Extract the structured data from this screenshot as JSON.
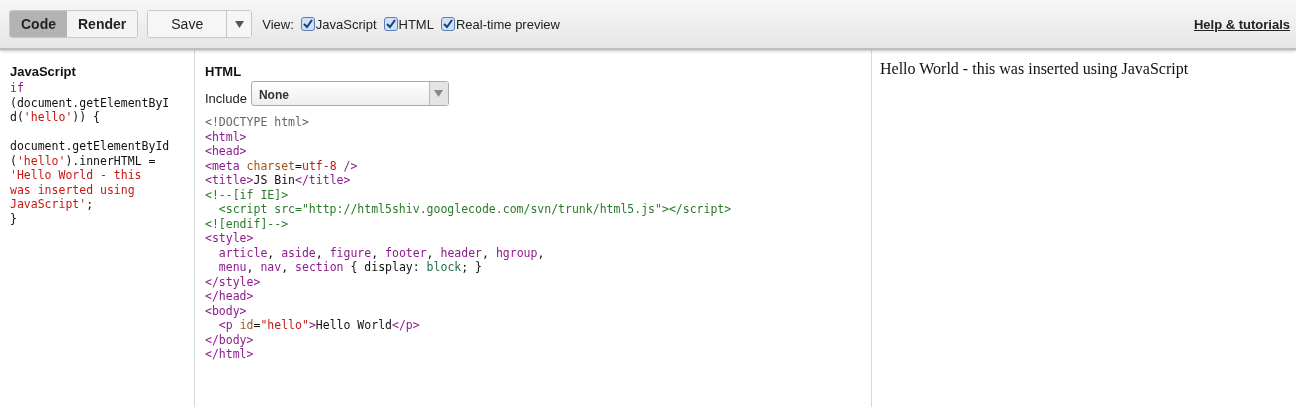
{
  "toolbar": {
    "mode_tabs": [
      {
        "label": "Code",
        "selected": true
      },
      {
        "label": "Render",
        "selected": false
      }
    ],
    "save_button": {
      "label": "Save"
    },
    "view_label": "View:",
    "view_options": [
      {
        "label": "JavaScript",
        "checked": true
      },
      {
        "label": "HTML",
        "checked": true
      },
      {
        "label": "Real-time preview",
        "checked": true
      }
    ],
    "help_link": "Help & tutorials"
  },
  "javascript_panel": {
    "title": "JavaScript",
    "lines": [
      [
        {
          "kind": "keyword",
          "text": "if"
        }
      ],
      [
        {
          "kind": "plain",
          "text": "(document.getElementByI"
        }
      ],
      [
        {
          "kind": "plain",
          "text": "d("
        },
        {
          "kind": "string",
          "text": "'hello'"
        },
        {
          "kind": "plain",
          "text": ")) {"
        }
      ],
      [
        {
          "kind": "plain",
          "text": "document.getElementById",
          "blank_before": true
        }
      ],
      [
        {
          "kind": "plain",
          "text": "("
        },
        {
          "kind": "string",
          "text": "'hello'"
        },
        {
          "kind": "plain",
          "text": ").innerHTML ="
        }
      ],
      [
        {
          "kind": "string",
          "text": "'Hello World - this"
        }
      ],
      [
        {
          "kind": "string",
          "text": "was inserted using"
        }
      ],
      [
        {
          "kind": "string",
          "text": "JavaScript'"
        },
        {
          "kind": "plain",
          "text": ";"
        }
      ],
      [
        {
          "kind": "plain",
          "text": "}"
        }
      ]
    ]
  },
  "html_panel": {
    "title": "HTML",
    "include_label": "Include",
    "include_value": "None",
    "lines": [
      [
        {
          "kind": "doctype",
          "text": "<!DOCTYPE html>"
        }
      ],
      [
        {
          "kind": "tag",
          "text": "<html>"
        }
      ],
      [
        {
          "kind": "tag",
          "text": "<head>"
        }
      ],
      [
        {
          "kind": "tag",
          "text": "<meta "
        },
        {
          "kind": "attr",
          "text": "charset"
        },
        {
          "kind": "plain",
          "text": "="
        },
        {
          "kind": "string",
          "text": "utf-8"
        },
        {
          "kind": "tag",
          "text": " />"
        }
      ],
      [
        {
          "kind": "tag",
          "text": "<title>"
        },
        {
          "kind": "plain",
          "text": "JS Bin"
        },
        {
          "kind": "tag",
          "text": "</title>"
        }
      ],
      [
        {
          "kind": "comment",
          "text": "<!--[if IE]>"
        }
      ],
      [
        {
          "kind": "comment",
          "text": "  <script src=\"http://html5shiv.googlecode.com/svn/trunk/html5.js\"></script>"
        }
      ],
      [
        {
          "kind": "comment",
          "text": "<![endif]-->"
        }
      ],
      [
        {
          "kind": "tag",
          "text": "<style>"
        }
      ],
      [
        {
          "kind": "tag",
          "text": "  article"
        },
        {
          "kind": "plain",
          "text": ", "
        },
        {
          "kind": "tag",
          "text": "aside"
        },
        {
          "kind": "plain",
          "text": ", "
        },
        {
          "kind": "tag",
          "text": "figure"
        },
        {
          "kind": "plain",
          "text": ", "
        },
        {
          "kind": "tag",
          "text": "footer"
        },
        {
          "kind": "plain",
          "text": ", "
        },
        {
          "kind": "tag",
          "text": "header"
        },
        {
          "kind": "plain",
          "text": ", "
        },
        {
          "kind": "tag",
          "text": "hgroup"
        },
        {
          "kind": "plain",
          "text": ","
        }
      ],
      [
        {
          "kind": "tag",
          "text": "  menu"
        },
        {
          "kind": "plain",
          "text": ", "
        },
        {
          "kind": "tag",
          "text": "nav"
        },
        {
          "kind": "plain",
          "text": ", "
        },
        {
          "kind": "tag",
          "text": "section"
        },
        {
          "kind": "plain",
          "text": " { display: "
        },
        {
          "kind": "value",
          "text": "block"
        },
        {
          "kind": "plain",
          "text": "; }"
        }
      ],
      [
        {
          "kind": "tag",
          "text": "</style>"
        }
      ],
      [
        {
          "kind": "tag",
          "text": "</head>"
        }
      ],
      [
        {
          "kind": "tag",
          "text": "<body>"
        }
      ],
      [
        {
          "kind": "tag",
          "text": "  <p "
        },
        {
          "kind": "attr",
          "text": "id"
        },
        {
          "kind": "plain",
          "text": "="
        },
        {
          "kind": "string",
          "text": "\"hello\""
        },
        {
          "kind": "tag",
          "text": ">"
        },
        {
          "kind": "plain",
          "text": "Hello World"
        },
        {
          "kind": "tag",
          "text": "</p>"
        }
      ],
      [
        {
          "kind": "tag",
          "text": "</body>"
        }
      ],
      [
        {
          "kind": "tag",
          "text": "</html>"
        }
      ]
    ]
  },
  "preview": {
    "text": "Hello World - this was inserted using JavaScript"
  }
}
